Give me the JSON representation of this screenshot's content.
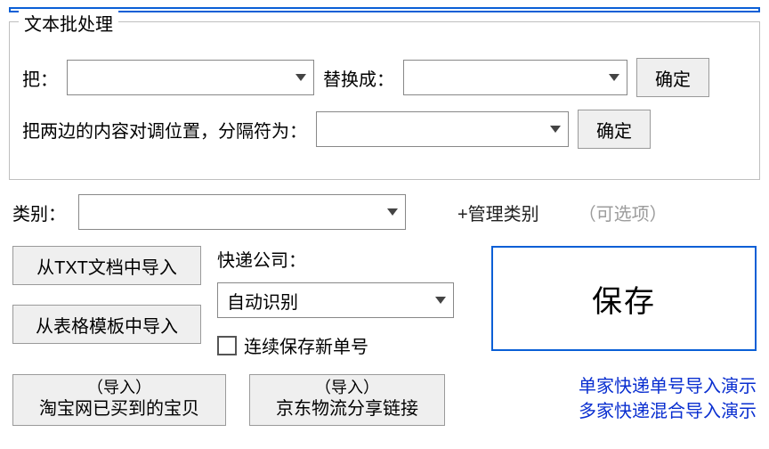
{
  "batch": {
    "legend": "文本批处理",
    "replace_from_label": "把：",
    "replace_to_label": "替换成：",
    "confirm1": "确定",
    "swap_label": "把两边的内容对调位置，分隔符为：",
    "confirm2": "确定",
    "from_value": "",
    "to_value": "",
    "sep_value": ""
  },
  "category": {
    "label": "类别：",
    "value": "",
    "manage": "+管理类别",
    "optional": "（可选项）"
  },
  "import_txt": "从TXT文档中导入",
  "import_tpl": "从表格模板中导入",
  "express": {
    "label": "快递公司：",
    "value": "自动识别",
    "continuous": "连续保存新单号"
  },
  "save": "保存",
  "taobao": {
    "top": "（导入）",
    "bot": "淘宝网已买到的宝贝"
  },
  "jd": {
    "top": "（导入）",
    "bot": "京东物流分享链接"
  },
  "demo1": "单家快递单号导入演示",
  "demo2": "多家快递混合导入演示"
}
